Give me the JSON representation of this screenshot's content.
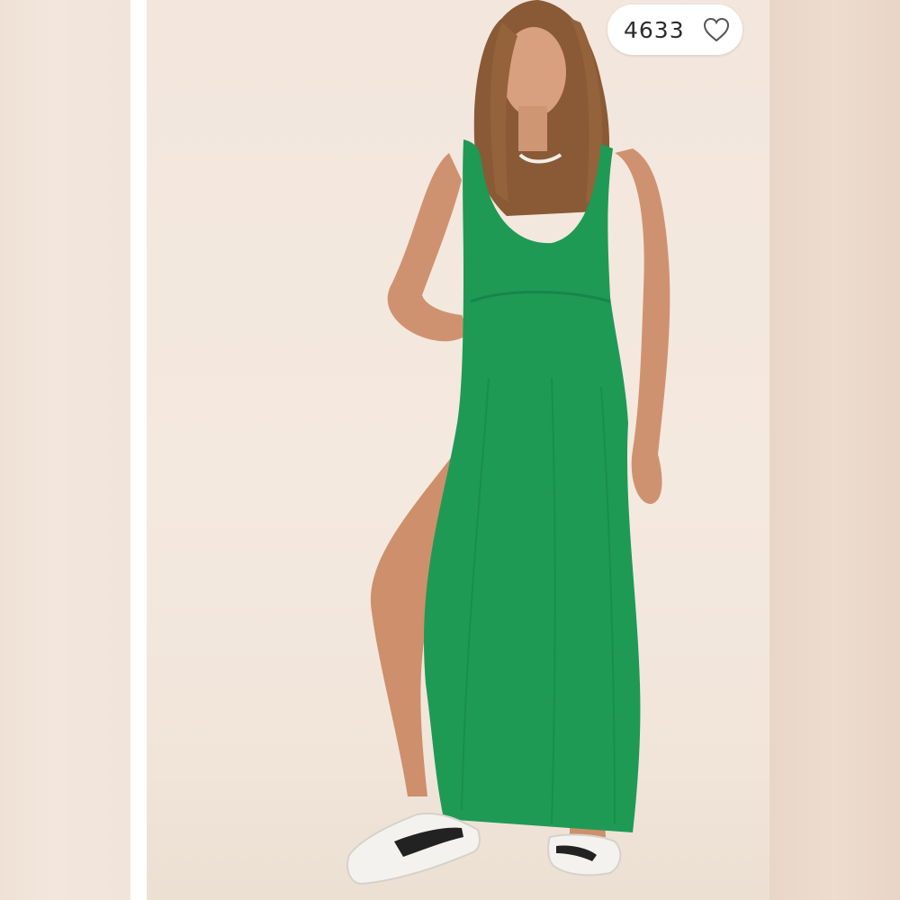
{
  "listing": {
    "like_count": "4633"
  },
  "icons": {
    "like": "heart-outline-icon"
  },
  "colors": {
    "dress": "#1e9a55",
    "background": "#f3e8de",
    "pill_bg": "#ffffff",
    "text": "#2b2b2b"
  }
}
